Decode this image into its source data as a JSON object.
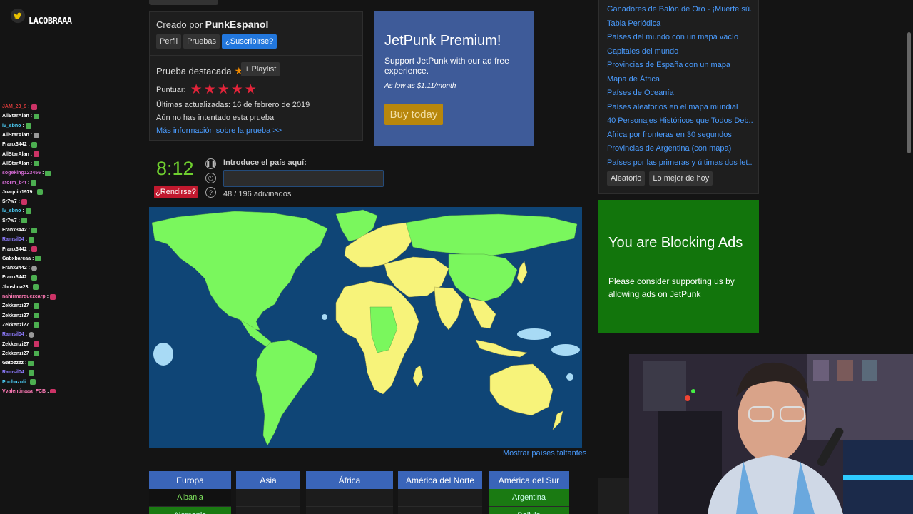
{
  "overlay": {
    "streamer_name": "LACOBRAAA",
    "chat": [
      {
        "user": "JAM_23_9",
        "color": "#d43a3a"
      },
      {
        "user": "AllStarAlan",
        "color": "#ffffff"
      },
      {
        "user": "lv_sbno",
        "color": "#4ed4ff"
      },
      {
        "user": "AllStarAlan",
        "color": "#ffffff"
      },
      {
        "user": "Franx3442",
        "color": "#ffffff"
      },
      {
        "user": "AllStarAlan",
        "color": "#ffffff"
      },
      {
        "user": "AllStarAlan",
        "color": "#ffffff"
      },
      {
        "user": "sogeking123456",
        "color": "#d66cd6"
      },
      {
        "user": "storm_b4t",
        "color": "#d66cd6"
      },
      {
        "user": "Joaquin1979",
        "color": "#ffffff"
      },
      {
        "user": "Sr7w7",
        "color": "#ffffff"
      },
      {
        "user": "lv_sbno",
        "color": "#4ed4ff"
      },
      {
        "user": "Sr7w7",
        "color": "#ffffff"
      },
      {
        "user": "Franx3442",
        "color": "#ffffff"
      },
      {
        "user": "Ramsil04",
        "color": "#8f7cff"
      },
      {
        "user": "Franx3442",
        "color": "#ffffff"
      },
      {
        "user": "Gabxbarcaa",
        "color": "#ffffff"
      },
      {
        "user": "Franx3442",
        "color": "#ffffff"
      },
      {
        "user": "Franx3442",
        "color": "#ffffff"
      },
      {
        "user": "Jhoshua23",
        "color": "#ffffff"
      },
      {
        "user": "nahirmarquezcarp",
        "color": "#ff7ab6"
      },
      {
        "user": "Zekkenzi27",
        "color": "#ffffff"
      },
      {
        "user": "Zekkenzi27",
        "color": "#ffffff"
      },
      {
        "user": "Zekkenzi27",
        "color": "#ffffff"
      },
      {
        "user": "Ramsil04",
        "color": "#8f7cff"
      },
      {
        "user": "Zekkenzi27",
        "color": "#ffffff"
      },
      {
        "user": "Zekkenzi27",
        "color": "#ffffff"
      },
      {
        "user": "Gatozzzz",
        "color": "#ffffff"
      },
      {
        "user": "Ramsil04",
        "color": "#8f7cff"
      },
      {
        "user": "Pochozuli",
        "color": "#4ed4ff"
      },
      {
        "user": "Vvalentinaaa_FCB",
        "color": "#ff7ab6"
      }
    ]
  },
  "quiz_info": {
    "created_by_prefix": "Creado por",
    "author": "PunkEspanol",
    "profile_btn": "Perfil",
    "quizzes_btn": "Pruebas",
    "subscribe_btn": "¿Suscribirse?",
    "featured": "Prueba destacada",
    "playlist_btn": "+ Playlist",
    "rate_label": "Puntuar:",
    "updated": "Últimas actualizadas: 16 de febrero de 2019",
    "not_tried": "Aún no has intentado esta prueba",
    "more_info": "Más información sobre la prueba >>"
  },
  "premium": {
    "title": "JetPunk Premium!",
    "text": "Support JetPunk with our ad free experience.",
    "price": "As low as $1.11/month",
    "buy": "Buy today"
  },
  "game": {
    "timer": "8:12",
    "give_up": "¿Rendirse?",
    "answer_label": "Introduce el país aquí:",
    "answer_value": "",
    "progress": "48 / 196 adivinados",
    "show_missing": "Mostrar países faltantes"
  },
  "continents": [
    {
      "name": "Europa",
      "cells": [
        "Albania",
        "Alemania"
      ]
    },
    {
      "name": "Asia",
      "cells": [
        "",
        ""
      ]
    },
    {
      "name": "África",
      "cells": [
        "",
        ""
      ]
    },
    {
      "name": "América del Norte",
      "cells": [
        "",
        ""
      ]
    },
    {
      "name": "América del Sur",
      "cells": [
        "Argentina",
        "Bolivia"
      ]
    }
  ],
  "related": {
    "links": [
      "Ganadores de Balón de Oro - ¡Muerte sú...",
      "Tabla Periódica",
      "Países del mundo con un mapa vacío",
      "Capitales del mundo",
      "Provincias de España con un mapa",
      "Mapa de África",
      "Países de Oceanía",
      "Países aleatorios en el mapa mundial",
      "40 Personajes Históricos que Todos Deb...",
      "África por fronteras en 30 segundos",
      "Provincias de Argentina (con mapa)",
      "Países por las primeras y últimas dos let..."
    ],
    "random_btn": "Aleatorio",
    "best_btn": "Lo mejor de hoy"
  },
  "adblock": {
    "title": "You are Blocking Ads",
    "text": "Please consider supporting us by allowing ads on JetPunk"
  }
}
